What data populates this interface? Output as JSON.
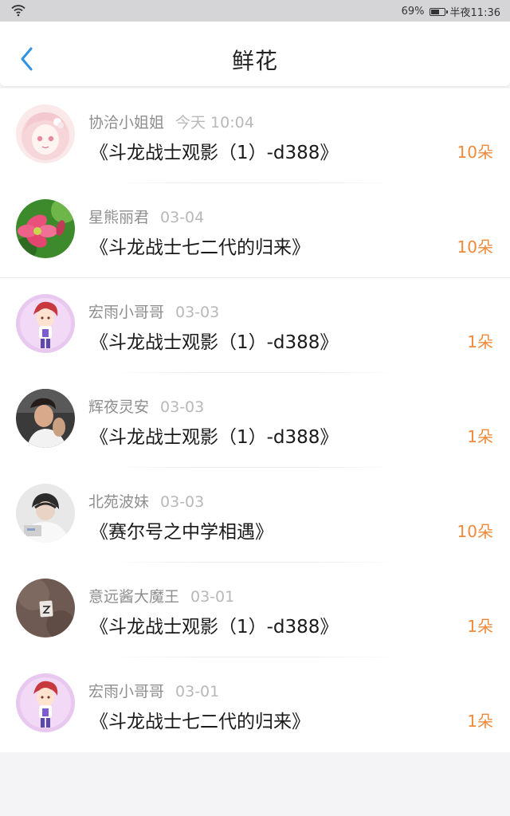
{
  "status_bar": {
    "battery": "69%",
    "time": "半夜11:36",
    "battery_level": 0.69
  },
  "header": {
    "title": "鲜花"
  },
  "colors": {
    "accent_blue": "#2f93e6",
    "count_orange": "#f08a3a"
  },
  "items": [
    {
      "user": "协洽小姐姐",
      "time": "今天 10:04",
      "work": "《斗龙战士观影（1）-d388》",
      "count": "10朵",
      "avatar_icon": "anime-girl-avatar"
    },
    {
      "user": "星熊丽君",
      "time": "03-04",
      "work": "《斗龙战士七二代的归来》",
      "count": "10朵",
      "avatar_icon": "pink-flower-avatar"
    },
    {
      "user": "宏雨小哥哥",
      "time": "03-03",
      "work": "《斗龙战士观影（1）-d388》",
      "count": "1朵",
      "avatar_icon": "anime-boy-avatar"
    },
    {
      "user": "辉夜灵安",
      "time": "03-03",
      "work": "《斗龙战士观影（1）-d388》",
      "count": "1朵",
      "avatar_icon": "man-photo-avatar"
    },
    {
      "user": "北苑波妹",
      "time": "03-03",
      "work": "《赛尔号之中学相遇》",
      "count": "10朵",
      "avatar_icon": "boy-photo-avatar"
    },
    {
      "user": "意远酱大魔王",
      "time": "03-01",
      "work": "《斗龙战士观影（1）-d388》",
      "count": "1朵",
      "avatar_icon": "paper-photo-avatar"
    },
    {
      "user": "宏雨小哥哥",
      "time": "03-01",
      "work": "《斗龙战士七二代的归来》",
      "count": "1朵",
      "avatar_icon": "anime-boy-avatar"
    }
  ]
}
